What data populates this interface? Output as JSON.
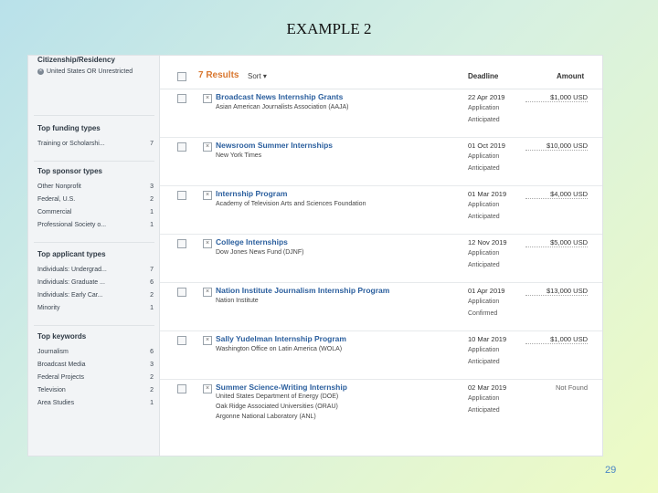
{
  "slide": {
    "title": "EXAMPLE 2",
    "page_number": "29"
  },
  "sidebar": {
    "citizenship": {
      "heading": "Citizenship/Residency",
      "filter": "United States OR Unrestricted"
    },
    "funding": {
      "heading": "Top funding types",
      "items": [
        {
          "label": "Training or Scholarshi...",
          "count": "7"
        }
      ]
    },
    "sponsor": {
      "heading": "Top sponsor types",
      "items": [
        {
          "label": "Other Nonprofit",
          "count": "3"
        },
        {
          "label": "Federal, U.S.",
          "count": "2"
        },
        {
          "label": "Commercial",
          "count": "1"
        },
        {
          "label": "Professional Society o...",
          "count": "1"
        }
      ]
    },
    "applicant": {
      "heading": "Top applicant types",
      "items": [
        {
          "label": "Individuals: Undergrad...",
          "count": "7"
        },
        {
          "label": "Individuals: Graduate ...",
          "count": "6"
        },
        {
          "label": "Individuals: Early Car...",
          "count": "2"
        },
        {
          "label": "Minority",
          "count": "1"
        }
      ]
    },
    "keywords": {
      "heading": "Top keywords",
      "items": [
        {
          "label": "Journalism",
          "count": "6"
        },
        {
          "label": "Broadcast Media",
          "count": "3"
        },
        {
          "label": "Federal Projects",
          "count": "2"
        },
        {
          "label": "Television",
          "count": "2"
        },
        {
          "label": "Area Studies",
          "count": "1"
        }
      ]
    }
  },
  "header": {
    "results": "7 Results",
    "sort": "Sort ▾",
    "deadline": "Deadline",
    "amount": "Amount"
  },
  "rows": [
    {
      "title": "Broadcast News Internship Grants",
      "sponsors": [
        "Asian American Journalists Association (AAJA)"
      ],
      "date": "22 Apr 2019",
      "line1": "Application",
      "line2": "Anticipated",
      "amount": "$1,000 USD"
    },
    {
      "title": "Newsroom Summer Internships",
      "sponsors": [
        "New York Times"
      ],
      "date": "01 Oct 2019",
      "line1": "Application",
      "line2": "Anticipated",
      "amount": "$10,000 USD"
    },
    {
      "title": "Internship Program",
      "sponsors": [
        "Academy of Television Arts and Sciences Foundation"
      ],
      "date": "01 Mar 2019",
      "line1": "Application",
      "line2": "Anticipated",
      "amount": "$4,000 USD"
    },
    {
      "title": "College Internships",
      "sponsors": [
        "Dow Jones News Fund (DJNF)"
      ],
      "date": "12 Nov 2019",
      "line1": "Application",
      "line2": "Anticipated",
      "amount": "$5,000 USD"
    },
    {
      "title": "Nation Institute Journalism Internship Program",
      "sponsors": [
        "Nation Institute"
      ],
      "date": "01 Apr 2019",
      "line1": "Application",
      "line2": "Confirmed",
      "amount": "$13,000 USD"
    },
    {
      "title": "Sally Yudelman Internship Program",
      "sponsors": [
        "Washington Office on Latin America (WOLA)"
      ],
      "date": "10 Mar 2019",
      "line1": "Application",
      "line2": "Anticipated",
      "amount": "$1,000 USD"
    },
    {
      "title": "Summer Science-Writing Internship",
      "sponsors": [
        "United States Department of Energy (DOE)",
        "Oak Ridge Associated Universities (ORAU)",
        "Argonne National Laboratory (ANL)"
      ],
      "date": "02 Mar 2019",
      "line1": "Application",
      "line2": "Anticipated",
      "amount": "Not Found"
    }
  ]
}
